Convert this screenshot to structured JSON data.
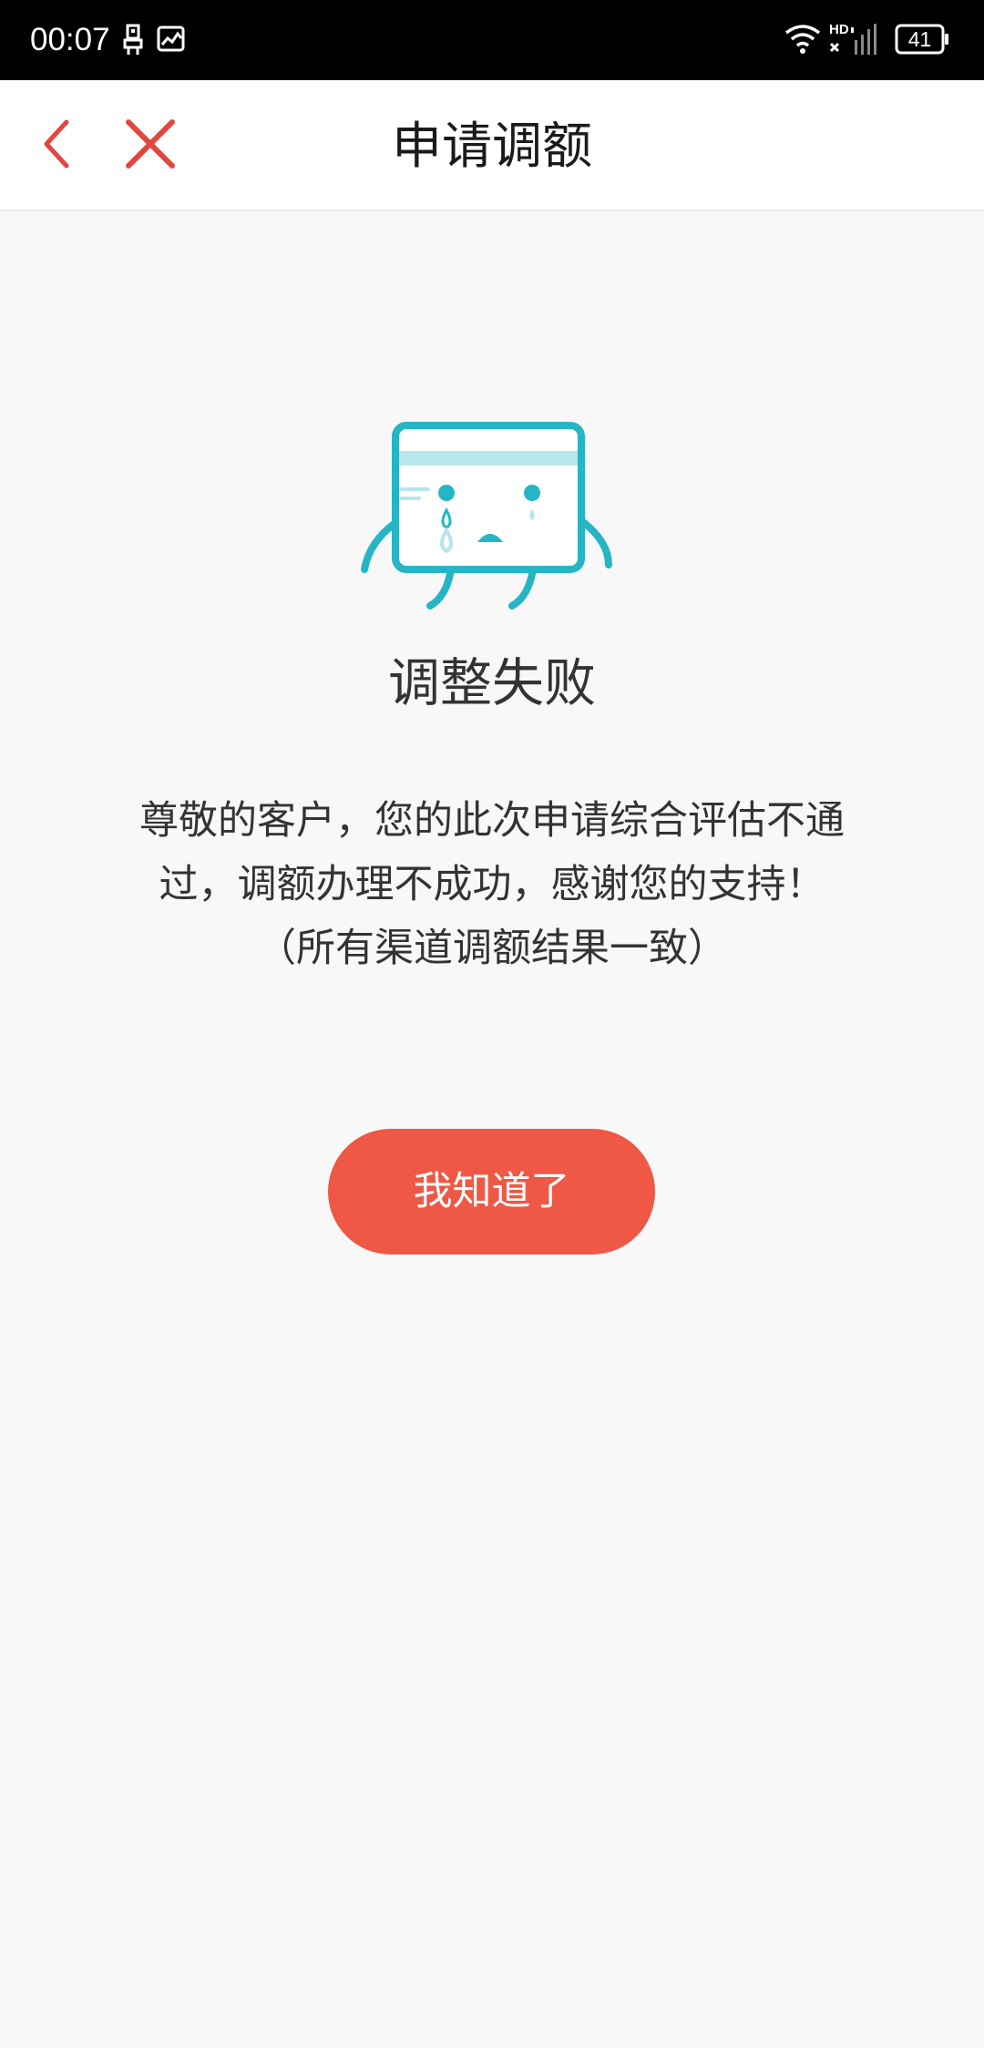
{
  "status_bar": {
    "time": "00:07",
    "battery": "41",
    "network": "HD"
  },
  "nav": {
    "title": "申请调额"
  },
  "result": {
    "title": "调整失败",
    "message_lines": [
      "尊敬的客户，您的此次申请综合评估不通",
      "过，调额办理不成功，感谢您的支持！",
      "（所有渠道调额结果一致）"
    ]
  },
  "actions": {
    "confirm_label": "我知道了"
  },
  "colors": {
    "accent": "#ef5845",
    "illustration": "#26b5c4",
    "illustration_light": "#b7e6ec",
    "background": "#f8f8f8"
  },
  "icons": [
    "usb-debug-icon",
    "gallery-icon",
    "wifi-icon",
    "signal-icon",
    "battery-icon",
    "back-arrow-icon",
    "close-icon"
  ]
}
